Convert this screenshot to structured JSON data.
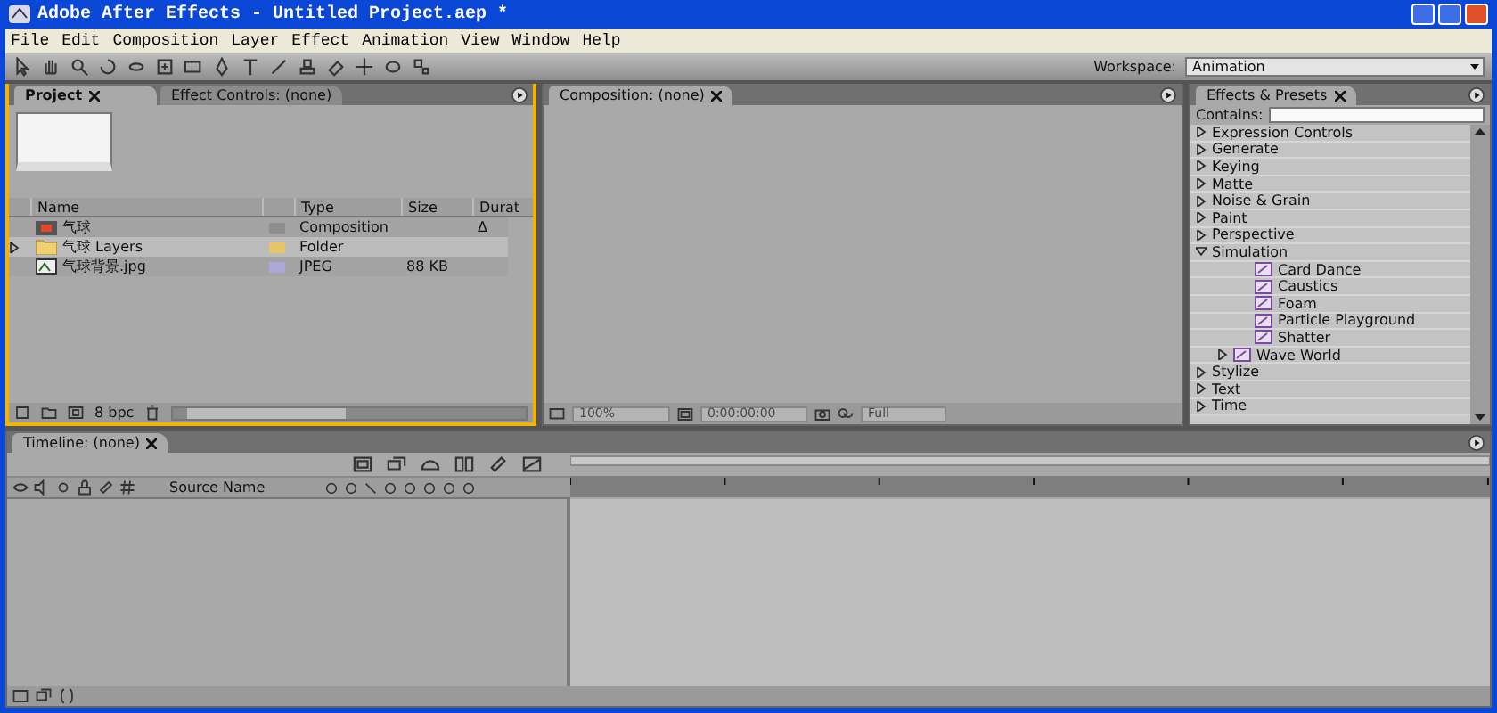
{
  "window": {
    "title": "Adobe After Effects - Untitled Project.aep *"
  },
  "menu": [
    "File",
    "Edit",
    "Composition",
    "Layer",
    "Effect",
    "Animation",
    "View",
    "Window",
    "Help"
  ],
  "workspace": {
    "label": "Workspace:",
    "value": "Animation"
  },
  "project_panel": {
    "tabs": [
      {
        "label": "Project",
        "selected": true
      },
      {
        "label": "Effect Controls: (none)",
        "selected": false
      }
    ],
    "columns": [
      "Name",
      "Type",
      "Size",
      "Durat"
    ],
    "rows": [
      {
        "kind": "composition",
        "name": "气球",
        "type": "Composition",
        "duration": "Δ",
        "color": "#8e8e8e"
      },
      {
        "kind": "folder",
        "name": "气球 Layers",
        "type": "Folder",
        "color": "#e6c468"
      },
      {
        "kind": "image",
        "name": "气球背景.jpg",
        "type": "JPEG",
        "size": "88 KB",
        "color": "#aaa8d8"
      }
    ],
    "bit_depth": "8 bpc"
  },
  "composition_panel": {
    "tab": "Composition: (none)",
    "zoom": "100%",
    "timecode": "0:00:00:00",
    "resolution": "Full"
  },
  "effects_panel": {
    "title": "Effects & Presets",
    "contains_label": "Contains:",
    "items": [
      {
        "kind": "category",
        "label": "Expression Controls",
        "expanded": false
      },
      {
        "kind": "category",
        "label": "Generate",
        "expanded": false
      },
      {
        "kind": "category",
        "label": "Keying",
        "expanded": false
      },
      {
        "kind": "category",
        "label": "Matte",
        "expanded": false
      },
      {
        "kind": "category",
        "label": "Noise & Grain",
        "expanded": false
      },
      {
        "kind": "category",
        "label": "Paint",
        "expanded": false
      },
      {
        "kind": "category",
        "label": "Perspective",
        "expanded": false
      },
      {
        "kind": "category",
        "label": "Simulation",
        "expanded": true,
        "children": [
          {
            "kind": "effect",
            "label": "Card Dance"
          },
          {
            "kind": "effect",
            "label": "Caustics"
          },
          {
            "kind": "effect",
            "label": "Foam"
          },
          {
            "kind": "effect",
            "label": "Particle Playground"
          },
          {
            "kind": "effect",
            "label": "Shatter"
          },
          {
            "kind": "effect",
            "label": "Wave World",
            "expanded": false
          }
        ]
      },
      {
        "kind": "category",
        "label": "Stylize",
        "expanded": false
      },
      {
        "kind": "category",
        "label": "Text",
        "expanded": false
      },
      {
        "kind": "category",
        "label": "Time",
        "expanded": false
      }
    ]
  },
  "timeline": {
    "tab": "Timeline: (none)",
    "source_column": "Source Name"
  }
}
